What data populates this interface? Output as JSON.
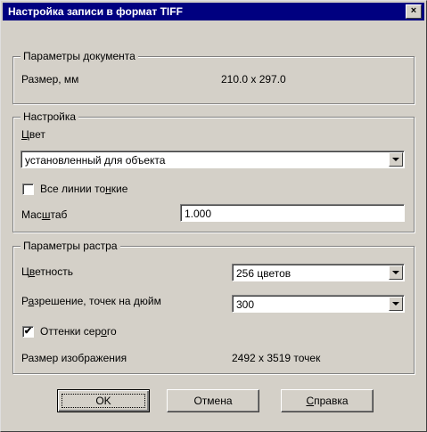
{
  "window": {
    "title": "Настройка записи в формат TIFF",
    "close_glyph": "×"
  },
  "doc_params": {
    "legend": "Параметры документа",
    "size_label": "Размер, мм",
    "size_value": "210.0 x 297.0"
  },
  "settings": {
    "legend": "Настройка",
    "color_label_u": "Ц",
    "color_label_rest": "вет",
    "color_value": "установленный для объекта",
    "thin_lines_pre": "Все линии то",
    "thin_lines_u": "н",
    "thin_lines_post": "кие",
    "thin_lines_checked": false,
    "scale_pre": "Мас",
    "scale_u": "ш",
    "scale_post": "таб",
    "scale_value": "1.000"
  },
  "raster": {
    "legend": "Параметры растра",
    "colordepth_pre": "Ц",
    "colordepth_u": "в",
    "colordepth_post": "етность",
    "colordepth_value": "256 цветов",
    "resolution_pre": "Р",
    "resolution_u": "а",
    "resolution_post": "зрешение, точек на дюйм",
    "resolution_value": "300",
    "grayscale_pre": "Оттенки сер",
    "grayscale_u": "о",
    "grayscale_post": "го",
    "grayscale_checked": true,
    "grayscale_mark": "✔",
    "image_size_label": "Размер изображения",
    "image_size_value": "2492 x 3519 точек"
  },
  "buttons": {
    "ok": "OK",
    "cancel": "Отмена",
    "help_u": "С",
    "help_rest": "правка"
  }
}
